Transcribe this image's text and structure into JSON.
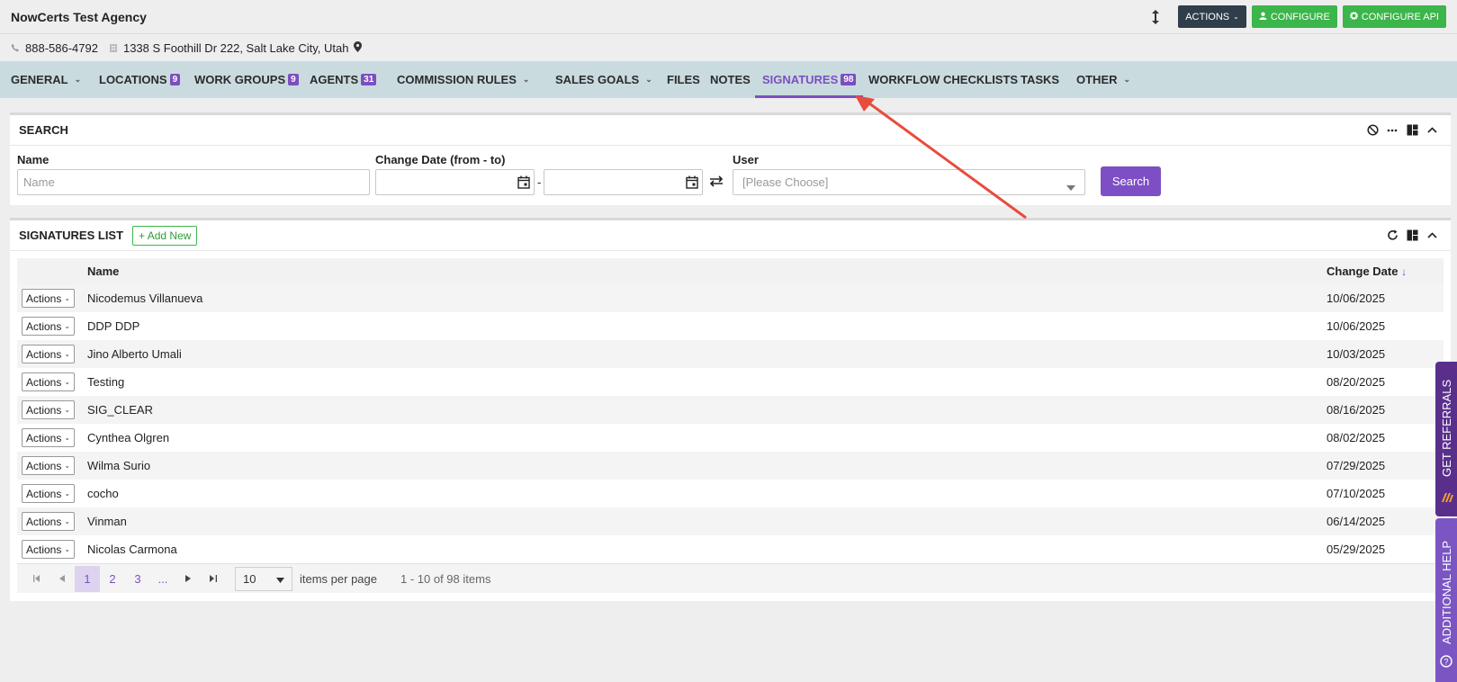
{
  "header": {
    "agency_name": "NowCerts Test Agency",
    "actions_label": "ACTIONS",
    "configure_label": "CONFIGURE",
    "configure_api_label": "CONFIGURE API",
    "colors": {
      "dark_button": "#2f3e4a",
      "green_button": "#3cb54a",
      "accent": "#7c4fc0"
    }
  },
  "info": {
    "phone": "888-586-4792",
    "address": "1338 S Foothill Dr 222, Salt Lake City, Utah"
  },
  "nav": {
    "general": "GENERAL",
    "locations": "LOCATIONS",
    "locations_count": "9",
    "work_groups": "WORK GROUPS",
    "work_groups_count": "9",
    "agents": "AGENTS",
    "agents_count": "31",
    "commission_rules": "COMMISSION RULES",
    "sales_goals": "SALES GOALS",
    "files": "FILES",
    "notes": "NOTES",
    "signatures": "SIGNATURES",
    "signatures_count": "98",
    "workflow_checklists": "WORKFLOW CHECKLISTS",
    "tasks": "TASKS",
    "other": "OTHER"
  },
  "search": {
    "title": "SEARCH",
    "name_label": "Name",
    "name_placeholder": "Name",
    "date_label": "Change Date (from - to)",
    "date_separator": "-",
    "user_label": "User",
    "user_placeholder": "[Please Choose]",
    "search_button": "Search"
  },
  "list": {
    "title": "SIGNATURES LIST",
    "add_new": "+ Add New",
    "col_name": "Name",
    "col_date": "Change Date",
    "actions_label": "Actions",
    "rows": [
      {
        "name": "Nicodemus Villanueva",
        "date": "10/06/2025"
      },
      {
        "name": "DDP DDP",
        "date": "10/06/2025"
      },
      {
        "name": "Jino Alberto Umali",
        "date": "10/03/2025"
      },
      {
        "name": "Testing",
        "date": "08/20/2025"
      },
      {
        "name": "SIG_CLEAR",
        "date": "08/16/2025"
      },
      {
        "name": "Cynthea Olgren",
        "date": "08/02/2025"
      },
      {
        "name": "Wilma Surio",
        "date": "07/29/2025"
      },
      {
        "name": "cocho",
        "date": "07/10/2025"
      },
      {
        "name": "Vinman",
        "date": "06/14/2025"
      },
      {
        "name": "Nicolas Carmona",
        "date": "05/29/2025"
      }
    ]
  },
  "pager": {
    "pages": [
      "1",
      "2",
      "3",
      "..."
    ],
    "per_page": "10",
    "per_page_label": "items per page",
    "info": "1 - 10 of 98 items"
  },
  "side": {
    "referrals": "GET REFERRALS",
    "help": "ADDITIONAL HELP"
  }
}
